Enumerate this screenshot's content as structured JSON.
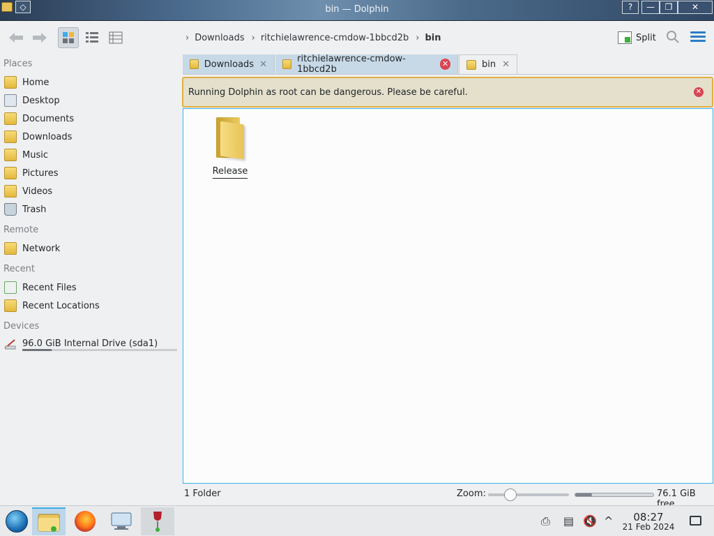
{
  "window": {
    "title": "bin — Dolphin",
    "help_label": "?",
    "minimize_label": "—",
    "maximize_label": "❐",
    "close_label": "✕"
  },
  "toolbar": {
    "back_icon": "arrow-left-icon",
    "forward_icon": "arrow-right-icon",
    "breadcrumb": [
      "Downloads",
      "ritchielawrence-cmdow-1bbcd2b",
      "bin"
    ],
    "split_label": "Split"
  },
  "sidebar": {
    "places_header": "Places",
    "places": [
      "Home",
      "Desktop",
      "Documents",
      "Downloads",
      "Music",
      "Pictures",
      "Videos",
      "Trash"
    ],
    "remote_header": "Remote",
    "remote": [
      "Network"
    ],
    "recent_header": "Recent",
    "recent": [
      "Recent Files",
      "Recent Locations"
    ],
    "devices_header": "Devices",
    "devices": [
      "96.0 GiB Internal Drive (sda1)"
    ],
    "drive_usage": 0.19
  },
  "tabs": [
    {
      "label": "Downloads",
      "active": false
    },
    {
      "label": "ritchielawrence-cmdow-1bbcd2b",
      "active": false
    },
    {
      "label": "bin",
      "active": true
    }
  ],
  "warning": {
    "text": "Running Dolphin as root can be dangerous. Please be careful."
  },
  "files": [
    {
      "name": "Release",
      "type": "folder"
    }
  ],
  "status": {
    "summary": "1 Folder",
    "zoom_label": "Zoom:",
    "free_space": "76.1 GiB free",
    "disk_used_fraction": 0.21,
    "zoom_fraction": 0.2
  },
  "taskbar": {
    "time": "08:27",
    "date": "21 Feb 2024"
  },
  "colors": {
    "accent": "#3daee9",
    "warning_border": "#e0b043",
    "close_red": "#da4453"
  }
}
